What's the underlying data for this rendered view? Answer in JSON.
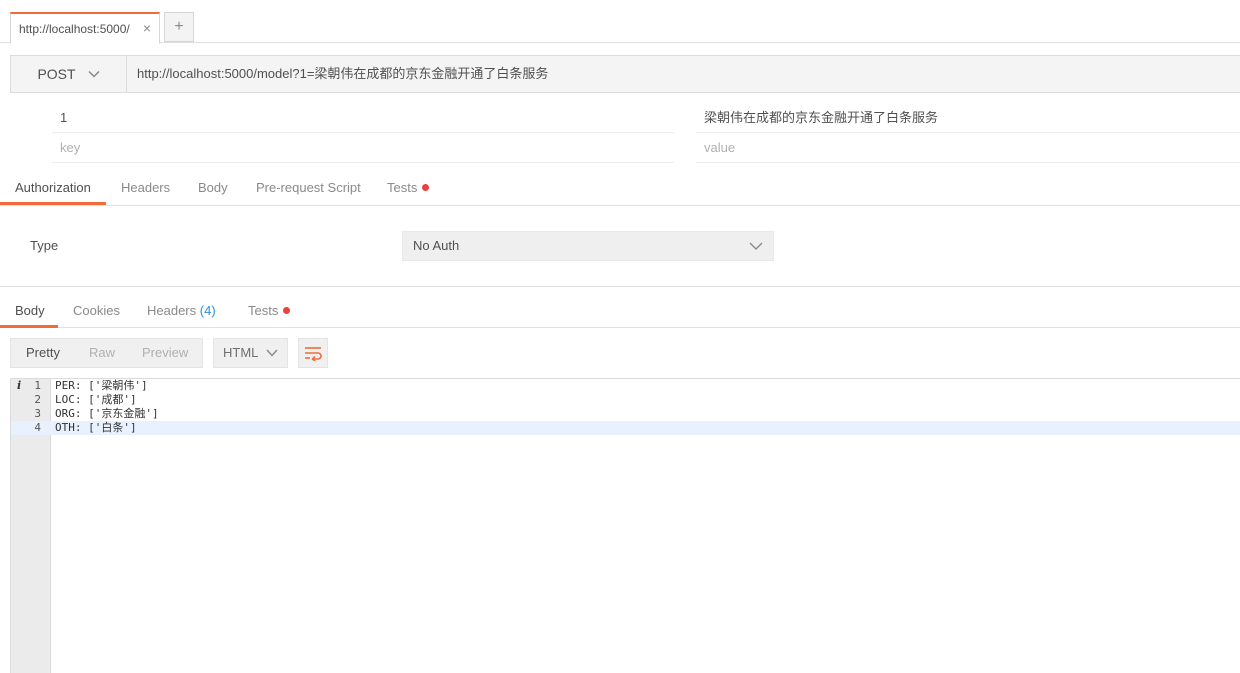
{
  "tabs": [
    {
      "label": "http://localhost:5000/",
      "close": "×"
    }
  ],
  "new_tab": "+",
  "request": {
    "method": "POST",
    "url": "http://localhost:5000/model?1=梁朝伟在成都的京东金融开通了白条服务"
  },
  "params": {
    "rows": [
      {
        "key": "1",
        "value": "梁朝伟在成都的京东金融开通了白条服务"
      }
    ],
    "key_placeholder": "key",
    "value_placeholder": "value"
  },
  "request_tabs": [
    "Authorization",
    "Headers",
    "Body",
    "Pre-request Script",
    "Tests"
  ],
  "auth": {
    "type_label": "Type",
    "selected": "No Auth"
  },
  "response_tabs": {
    "body": "Body",
    "cookies": "Cookies",
    "headers": "Headers",
    "headers_count": "(4)",
    "tests": "Tests"
  },
  "view_modes": [
    "Pretty",
    "Raw",
    "Preview"
  ],
  "format": "HTML",
  "response_lines": [
    {
      "num": "1",
      "text": "PER: ['梁朝伟']"
    },
    {
      "num": "2",
      "text": "LOC: ['成都']"
    },
    {
      "num": "3",
      "text": "ORG: ['京东金融']"
    },
    {
      "num": "4",
      "text": "OTH: ['白条']"
    }
  ],
  "colors": {
    "accent": "#f26b3a",
    "dot": "#e8423e",
    "link": "#2f8fd8"
  }
}
